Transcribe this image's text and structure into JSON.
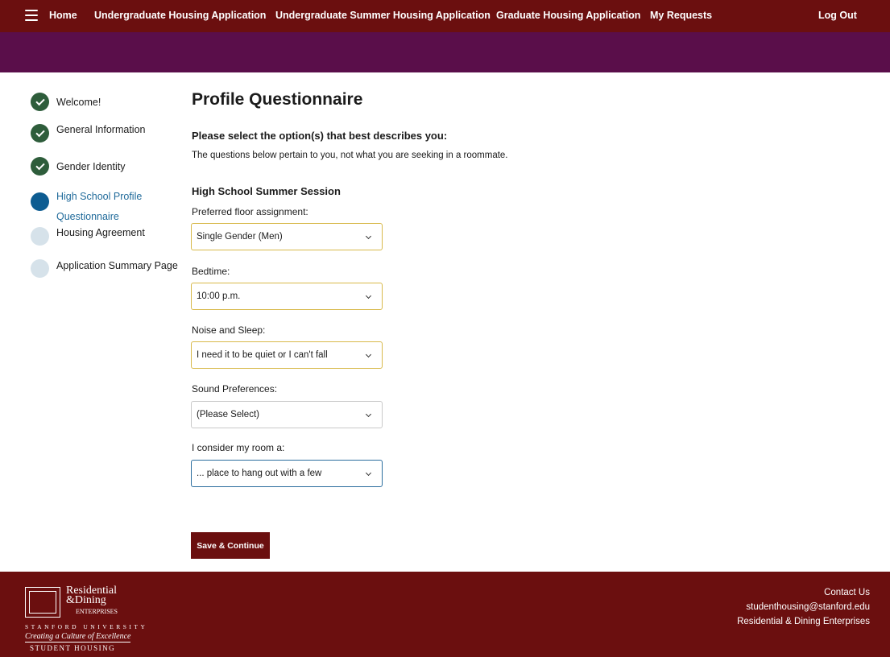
{
  "nav": {
    "home": "Home",
    "ug_housing": "Undergraduate Housing Application",
    "ug_summer": "Undergraduate Summer Housing Application",
    "grad_housing": "Graduate Housing Application",
    "my_requests": "My Requests",
    "logout": "Log Out"
  },
  "sidebar": {
    "steps": [
      {
        "label": "Welcome!",
        "status": "done"
      },
      {
        "label": "General Information",
        "status": "done"
      },
      {
        "label": "Gender Identity",
        "status": "done"
      },
      {
        "label_line1": "High School Profile",
        "label_line2": "Questionnaire",
        "status": "current"
      },
      {
        "label": "Housing Agreement",
        "status": "todo"
      },
      {
        "label": "Application Summary Page",
        "status": "todo"
      }
    ]
  },
  "main": {
    "title": "Profile Questionnaire",
    "instruction_heading": "Please select the option(s) that best describes you:",
    "instruction_text": "The questions below pertain to you, not what you are seeking in a roommate.",
    "section_heading": "High School Summer Session",
    "fields": [
      {
        "label": "Preferred floor assignment:",
        "value": "Single Gender (Men)"
      },
      {
        "label": "Bedtime:",
        "value": "10:00 p.m."
      },
      {
        "label": "Noise and Sleep:",
        "value": "I need it to be quiet or I can't fall"
      },
      {
        "label": "Sound Preferences:",
        "value": "(Please Select)"
      },
      {
        "label": "I consider my room a:",
        "value": "... place to hang out with a few"
      }
    ],
    "save_label": "Save & Continue"
  },
  "footer": {
    "logo": {
      "residential": "Residential",
      "dining": "&Dining",
      "enterprises": "ENTERPRISES",
      "stanford": "STANFORD UNIVERSITY",
      "culture": "Creating a Culture of Excellence",
      "student_housing": "STUDENT HOUSING"
    },
    "contact_label": "Contact Us",
    "email": "studenthousing@stanford.edu",
    "org": "Residential & Dining Enterprises"
  },
  "colors": {
    "nav_bg": "#6b0f0f",
    "purple_band": "#5a0e4a",
    "done": "#2e5d3b",
    "current": "#0d5c91",
    "todo": "#d6e2ea",
    "field_border_selected": "#d8b94a",
    "field_border_focused": "#2a6d9e"
  },
  "icons": {
    "menu": "hamburger-menu-icon",
    "done": "checkmark-icon",
    "select": "chevron-down-icon"
  }
}
